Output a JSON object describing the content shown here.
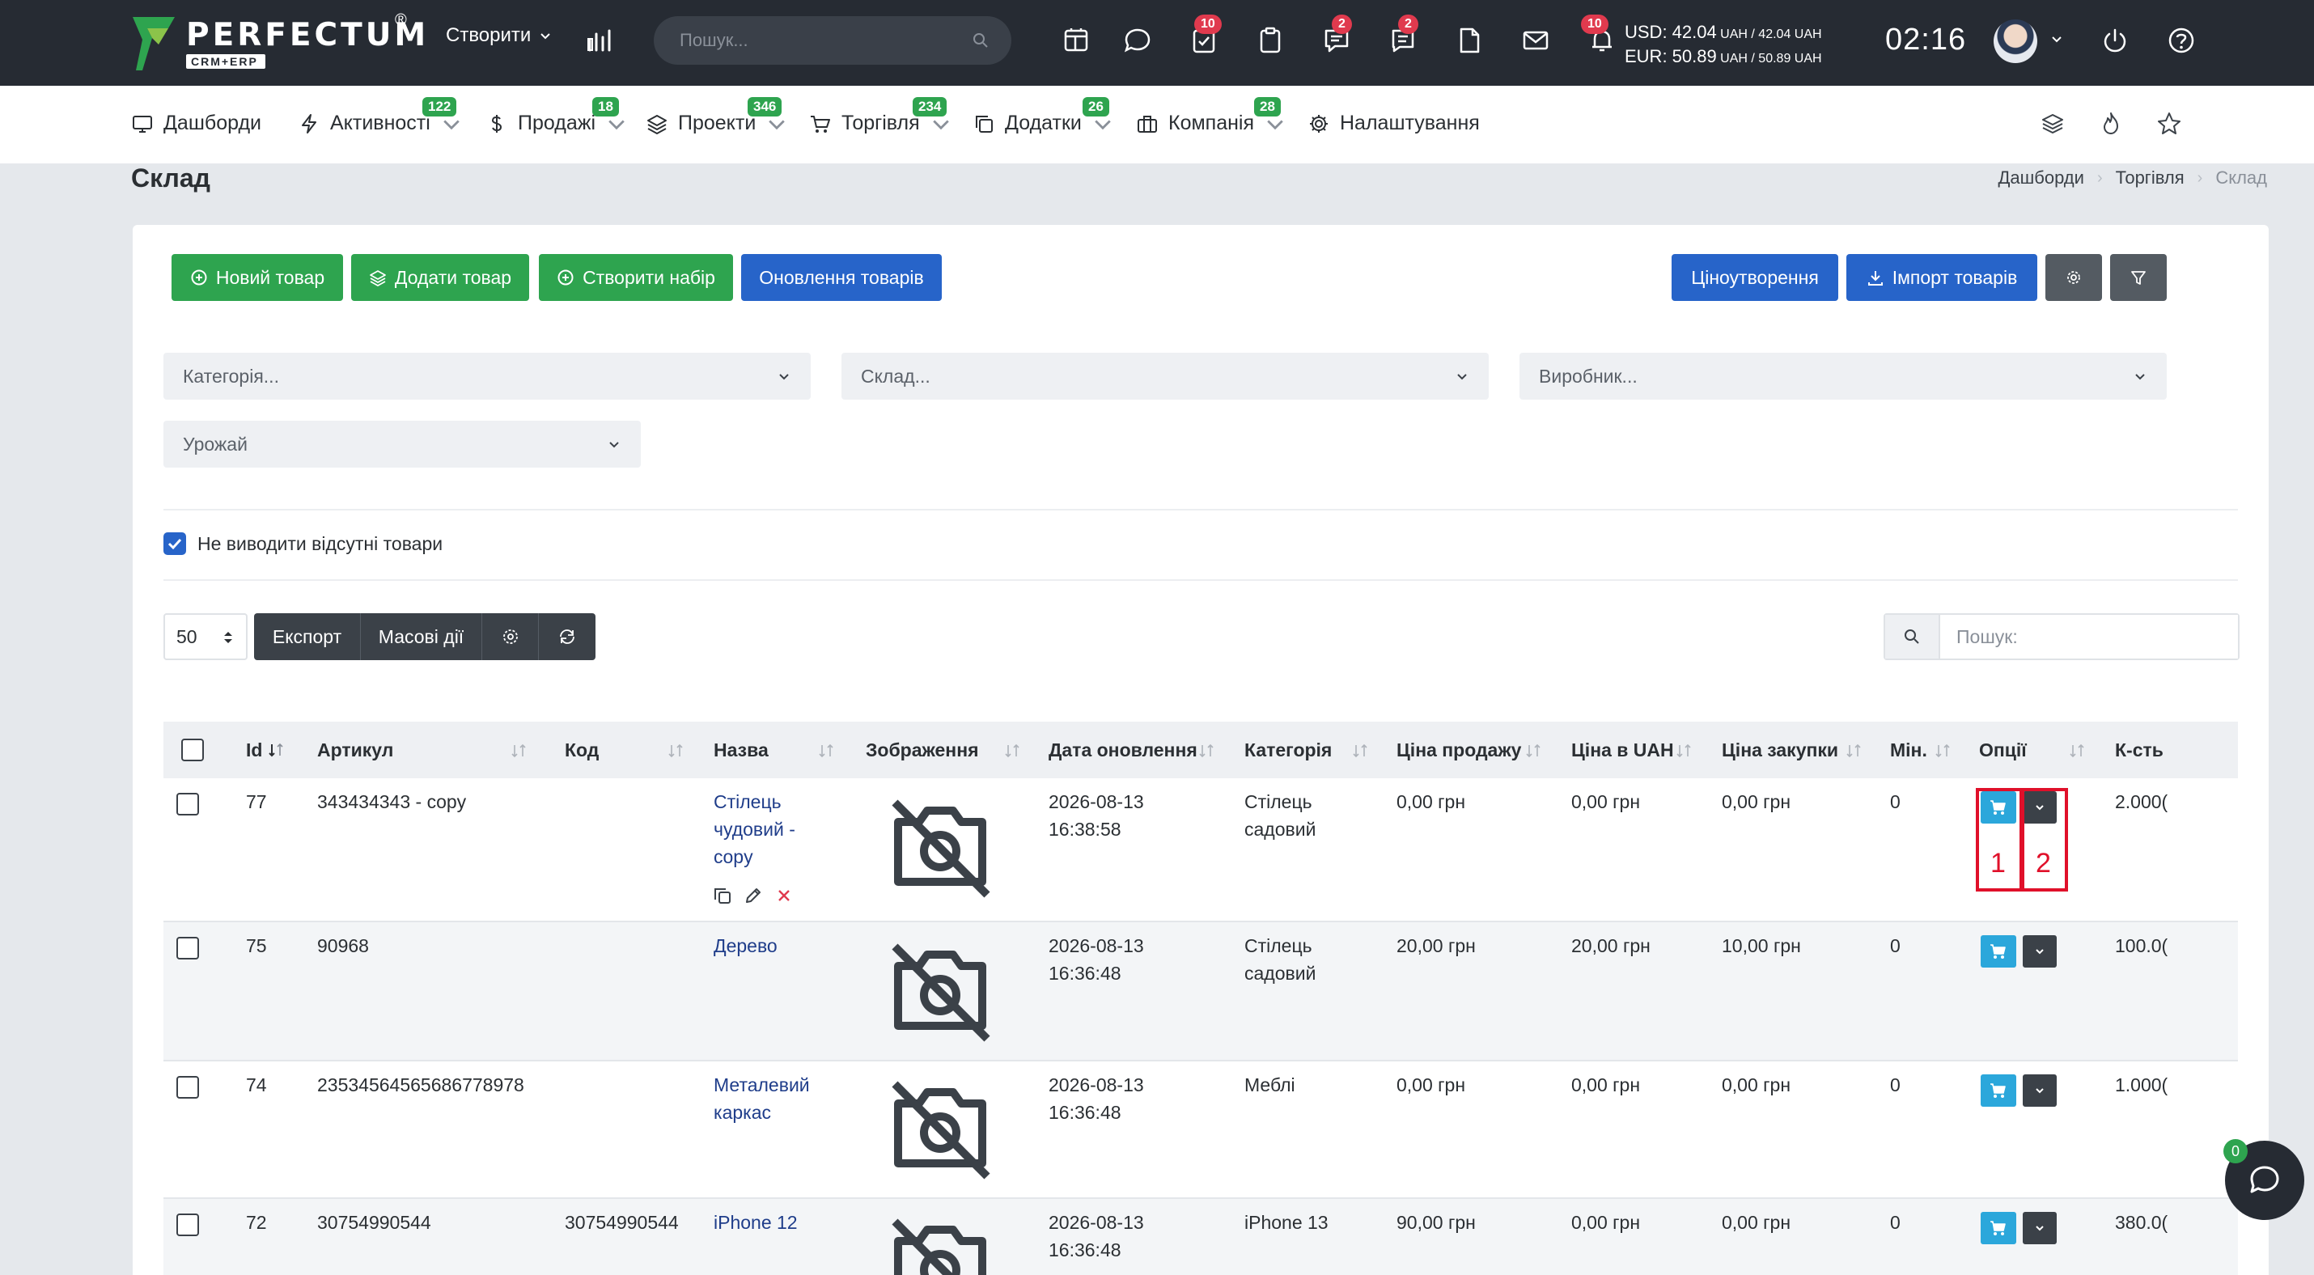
{
  "app": {
    "brand": "PERFECTUM",
    "brand_sub": "CRM+ERP",
    "reg_mark": "®"
  },
  "topbar": {
    "create_label": "Створити",
    "search_placeholder": "Пошук...",
    "badges": {
      "tasks": "10",
      "chat": "2",
      "messages": "2",
      "notifications": "10"
    },
    "currency_usd": "USD: 42.04",
    "currency_usd_mid": " UAH / 42.04",
    "currency_eur": "EUR: 50.89",
    "currency_eur_mid": " UAH / 50.89",
    "currency_unit": " UAH",
    "time": "02:16"
  },
  "nav": {
    "items": [
      {
        "label": "Дашборди",
        "badge": ""
      },
      {
        "label": "Активності",
        "badge": "122"
      },
      {
        "label": "Продажі",
        "badge": "18"
      },
      {
        "label": "Проекти",
        "badge": "346"
      },
      {
        "label": "Торгівля",
        "badge": "234"
      },
      {
        "label": "Додатки",
        "badge": "26"
      },
      {
        "label": "Компанія",
        "badge": "28"
      },
      {
        "label": "Налаштування",
        "badge": ""
      }
    ]
  },
  "page": {
    "title": "Склад",
    "breadcrumb": [
      "Дашборди",
      "Торгівля",
      "Склад"
    ]
  },
  "actions": {
    "new_product": "Новий товар",
    "add_product": "Додати товар",
    "create_set": "Створити набір",
    "update_products": "Оновлення товарів",
    "pricing": "Ціноутворення",
    "import_products": "Імпорт товарів"
  },
  "filters": {
    "category_placeholder": "Категорія...",
    "warehouse_placeholder": "Склад...",
    "manufacturer_placeholder": "Виробник...",
    "harvest_placeholder": "Урожай",
    "hide_missing_label": "Не виводити відсутні товари"
  },
  "toolbar": {
    "per_page": "50",
    "export": "Експорт",
    "bulk_actions": "Масові дії",
    "search_placeholder": "Пошук:"
  },
  "table": {
    "headers": {
      "id": "Id",
      "sku": "Артикул",
      "code": "Код",
      "name": "Назва",
      "image": "Зображення",
      "updated": "Дата оновлення",
      "category": "Категорія",
      "sale_price": "Ціна продажу",
      "price_uah": "Ціна в UAH",
      "purchase_price": "Ціна закупки",
      "min": "Мін.",
      "options": "Опції",
      "qty": "К-сть"
    },
    "rows": [
      {
        "id": "77",
        "sku": "343434343 - copy",
        "code": "",
        "name_1": "Стілець",
        "name_2": "чудовий -",
        "name_3": "copy",
        "date": "2026-08-13",
        "time": "16:38:58",
        "cat_1": "Стілець",
        "cat_2": "садовий",
        "sale": "0,00 грн",
        "uah": "0,00 грн",
        "purchase": "0,00 грн",
        "min": "0",
        "qty": "2.000("
      },
      {
        "id": "75",
        "sku": "90968",
        "code": "",
        "name_1": "Дерево",
        "name_2": "",
        "name_3": "",
        "date": "2026-08-13",
        "time": "16:36:48",
        "cat_1": "Стілець",
        "cat_2": "садовий",
        "sale": "20,00 грн",
        "uah": "20,00 грн",
        "purchase": "10,00 грн",
        "min": "0",
        "qty": "100.0("
      },
      {
        "id": "74",
        "sku": "23534564565686778978",
        "code": "",
        "name_1": "Металевий",
        "name_2": "каркас",
        "name_3": "",
        "date": "2026-08-13",
        "time": "16:36:48",
        "cat_1": "Меблі",
        "cat_2": "",
        "sale": "0,00 грн",
        "uah": "0,00 грн",
        "purchase": "0,00 грн",
        "min": "0",
        "qty": "1.000("
      },
      {
        "id": "72",
        "sku": "30754990544",
        "code": "30754990544",
        "name_1": "iPhone 12",
        "name_2": "",
        "name_3": "",
        "date": "2026-08-13",
        "time": "16:36:48",
        "cat_1": "iPhone 13",
        "cat_2": "",
        "sale": "90,00 грн",
        "uah": "0,00 грн",
        "purchase": "0,00 грн",
        "min": "0",
        "qty": "380.0("
      }
    ]
  },
  "annotations": {
    "one": "1",
    "two": "2"
  },
  "chat": {
    "badge": "0"
  }
}
